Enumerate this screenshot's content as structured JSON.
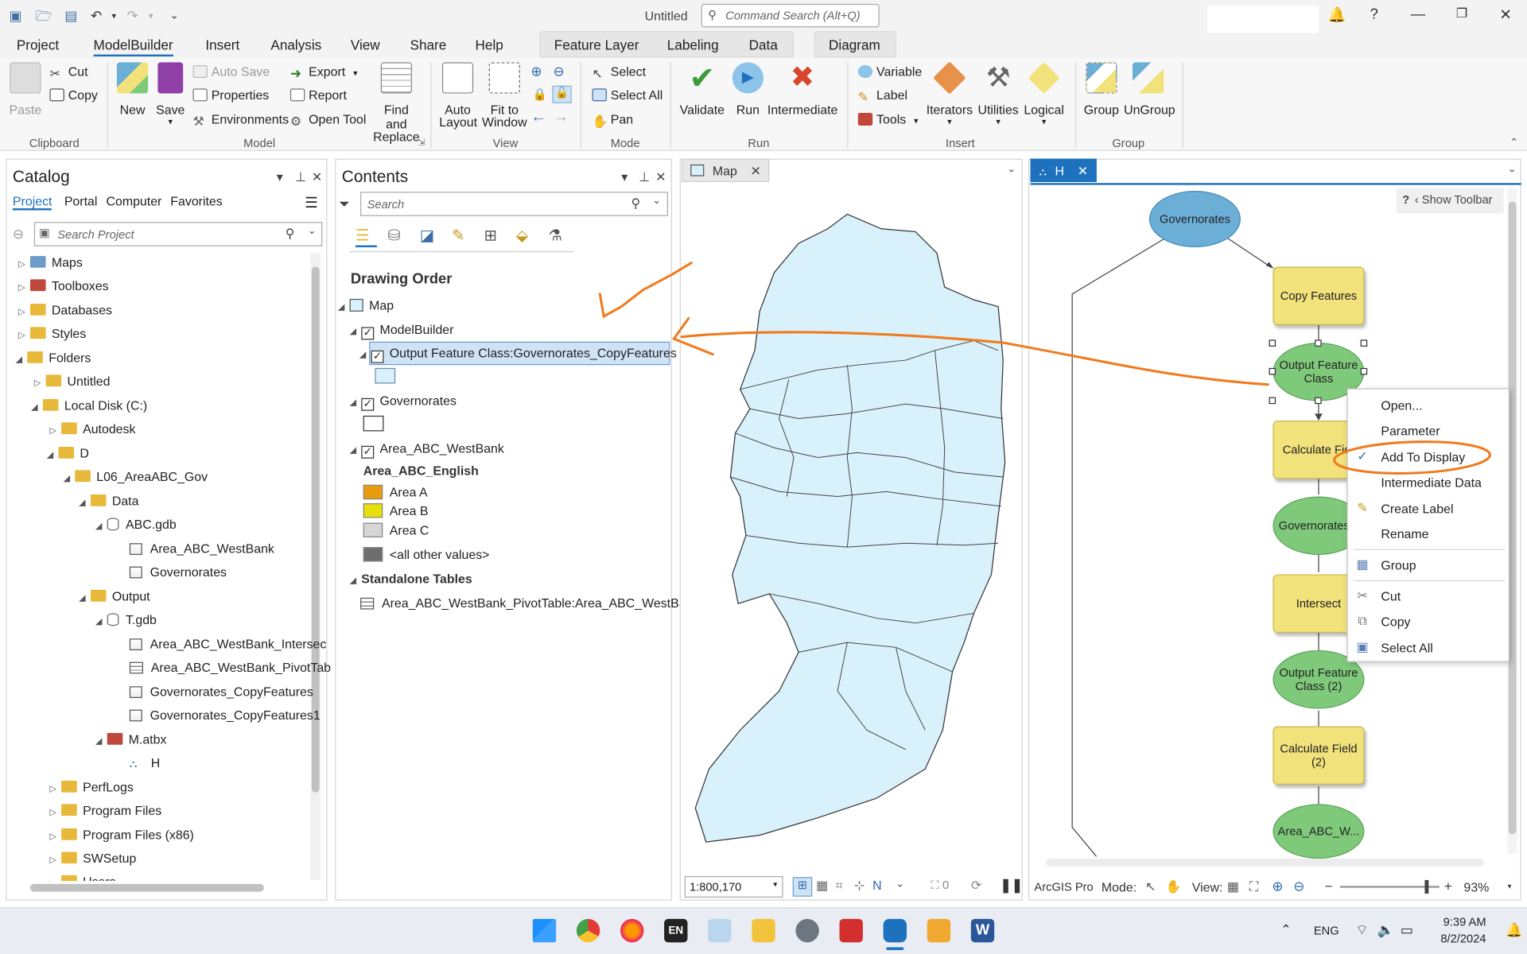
{
  "titlebar": {
    "doc_title": "Untitled",
    "command_search_placeholder": "Command Search (Alt+Q)"
  },
  "ribbon_tabs": {
    "project": "Project",
    "modelbuilder": "ModelBuilder",
    "insert": "Insert",
    "analysis": "Analysis",
    "view": "View",
    "share": "Share",
    "help": "Help",
    "feature_layer": "Feature Layer",
    "labeling": "Labeling",
    "data": "Data",
    "diagram": "Diagram"
  },
  "ribbon": {
    "clipboard": {
      "label": "Clipboard",
      "paste": "Paste",
      "cut": "Cut",
      "copy": "Copy"
    },
    "model": {
      "label": "Model",
      "new": "New",
      "save": "Save",
      "auto_save": "Auto Save",
      "properties": "Properties",
      "environments": "Environments",
      "export": "Export",
      "report": "Report",
      "open_tool": "Open Tool",
      "find_replace_1": "Find and",
      "find_replace_2": "Replace"
    },
    "view": {
      "label": "View",
      "auto_layout_1": "Auto",
      "auto_layout_2": "Layout",
      "fit_window_1": "Fit to",
      "fit_window_2": "Window"
    },
    "mode": {
      "label": "Mode",
      "select": "Select",
      "select_all": "Select All",
      "pan": "Pan"
    },
    "run": {
      "label": "Run",
      "validate": "Validate",
      "run": "Run",
      "intermediate": "Intermediate"
    },
    "insert": {
      "label": "Insert",
      "variable": "Variable",
      "label_btn": "Label",
      "tools": "Tools",
      "iterators": "Iterators",
      "utilities": "Utilities",
      "logical": "Logical"
    },
    "group": {
      "label": "Group",
      "group": "Group",
      "ungroup": "UnGroup"
    }
  },
  "catalog": {
    "title": "Catalog",
    "tabs": [
      "Project",
      "Portal",
      "Computer",
      "Favorites"
    ],
    "search_placeholder": "Search Project",
    "items": [
      "Maps",
      "Toolboxes",
      "Databases",
      "Styles",
      "Folders",
      "Untitled",
      "Local Disk (C:)",
      "Autodesk",
      "D",
      "L06_AreaABC_Gov",
      "Data",
      "ABC.gdb",
      "Area_ABC_WestBank",
      "Governorates",
      "Output",
      "T.gdb",
      "Area_ABC_WestBank_Intersec",
      "Area_ABC_WestBank_PivotTab",
      "Governorates_CopyFeatures",
      "Governorates_CopyFeatures1",
      "M.atbx",
      "H",
      "PerfLogs",
      "Program Files",
      "Program Files (x86)",
      "SWSetup",
      "Users"
    ]
  },
  "contents": {
    "title": "Contents",
    "search_placeholder": "Search",
    "drawing_order": "Drawing Order",
    "map": "Map",
    "modelbuilder": "ModelBuilder",
    "output_fc": "Output Feature Class:Governorates_CopyFeatures",
    "governorates": "Governorates",
    "area_abc": "Area_ABC_WestBank",
    "area_field": "Area_ABC_English",
    "legend": [
      {
        "label": "Area A",
        "color": "#e89c0b"
      },
      {
        "label": "Area B",
        "color": "#e8e00b"
      },
      {
        "label": "Area C",
        "color": "#d6d6d6"
      },
      {
        "label": "<all other values>",
        "color": "#6e6e6e"
      }
    ],
    "standalone": "Standalone Tables",
    "pivot": "Area_ABC_WestBank_PivotTable:Area_ABC_WestBank..."
  },
  "map_view": {
    "tab": "Map",
    "scale": "1:800,170",
    "selected_count": "0"
  },
  "model_view": {
    "tab": "H",
    "show_toolbar": "Show Toolbar",
    "nodes": {
      "governorates": "Governorates",
      "copy_features": "Copy Features",
      "output_fc_1": "Output Feature",
      "output_fc_2": "Class",
      "calculate_field": "Calculate Fie",
      "governorates_out": "Governorates_",
      "intersect": "Intersect",
      "output_fc2_1": "Output Feature",
      "output_fc2_2": "Class (2)",
      "calc_field2_1": "Calculate Field",
      "calc_field2_2": "(2)",
      "area_abc_w": "Area_ABC_W..."
    },
    "status_app": "ArcGIS Pro",
    "mode_label": "Mode:",
    "view_label": "View:",
    "zoom": "93%"
  },
  "context_menu": {
    "open": "Open...",
    "parameter": "Parameter",
    "add_to_display": "Add To Display",
    "intermediate_data": "Intermediate Data",
    "create_label": "Create Label",
    "rename": "Rename",
    "group": "Group",
    "cut": "Cut",
    "copy": "Copy",
    "select_all": "Select All"
  },
  "taskbar": {
    "lang_short": "EN",
    "lang": "ENG",
    "time": "9:39 AM",
    "date": "8/2/2024"
  },
  "colors": {
    "accent": "#1e72bd",
    "annotation": "#f07b1e",
    "model_tool": "#f2e27c",
    "model_data": "#7fc97a",
    "model_input": "#6baed6",
    "map_fill": "#d9f1fb"
  }
}
